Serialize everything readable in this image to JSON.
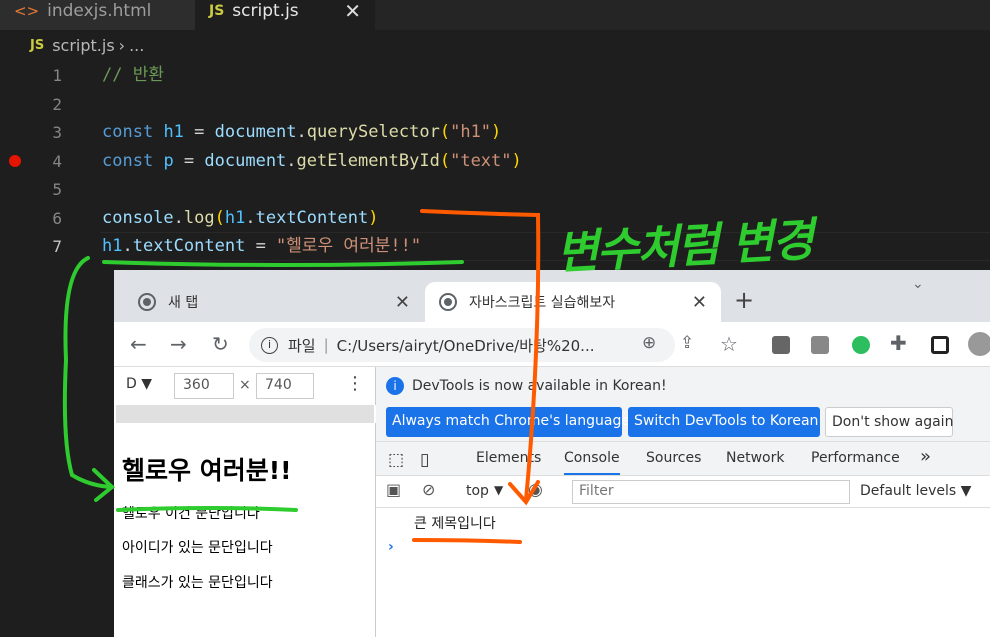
{
  "editor": {
    "tabs": [
      {
        "label": "indexjs.html"
      },
      {
        "label": "script.js",
        "close": "✕"
      }
    ],
    "breadcrumb": {
      "file": "script.js",
      "sep": "›",
      "more": "..."
    },
    "lines": [
      {
        "num": "1"
      },
      {
        "num": "2"
      },
      {
        "num": "3"
      },
      {
        "num": "4"
      },
      {
        "num": "5"
      },
      {
        "num": "6"
      },
      {
        "num": "7"
      }
    ],
    "code": {
      "l1": "// 반환",
      "l3": {
        "kw": "const",
        "var": "h1",
        "eq": " = ",
        "obj": "document",
        "fn": "querySelector",
        "arg": "\"h1\""
      },
      "l4": {
        "kw": "const",
        "var": "p",
        "eq": " = ",
        "obj": "document",
        "fn": "getElementById",
        "arg": "\"text\""
      },
      "l6": {
        "obj": "console",
        "fn": "log",
        "v": "h1",
        "prop": "textContent"
      },
      "l7": {
        "v": "h1",
        "prop": "textContent",
        "eq": " = ",
        "str": "\"헬로우 여러분!!\""
      }
    }
  },
  "annotation": {
    "handwriting": "변수처럼 변경"
  },
  "browser": {
    "tabs": [
      {
        "label": "새 탭"
      },
      {
        "label": "자바스크립트 실습해보자"
      }
    ],
    "omnibox": {
      "prefix": "파일",
      "url": "C:/Users/airyt/OneDrive/바탕%20..."
    },
    "device": {
      "name": "D ▼",
      "width": "360",
      "x": "×",
      "height": "740"
    },
    "page": {
      "h1": "헬로우 여러분!!",
      "paragraphs": [
        "헬로우 이건 문단입니다",
        "아이디가 있는 문단입니다",
        "클래스가 있는 문단입니다"
      ]
    },
    "devtools": {
      "notice": "DevTools is now available in Korean!",
      "buttons": [
        "Always match Chrome's language",
        "Switch DevTools to Korean",
        "Don't show again"
      ],
      "panels": [
        "Elements",
        "Console",
        "Sources",
        "Network",
        "Performance"
      ],
      "more": "»",
      "context": "top",
      "filter_placeholder": "Filter",
      "levels": "Default levels ▼",
      "log": "큰 제목입니다",
      "prompt": "›"
    }
  },
  "colors": {
    "annotation_green": "#2ecc2e",
    "annotation_orange": "#ff5a00",
    "accent": "#1a73e8"
  }
}
